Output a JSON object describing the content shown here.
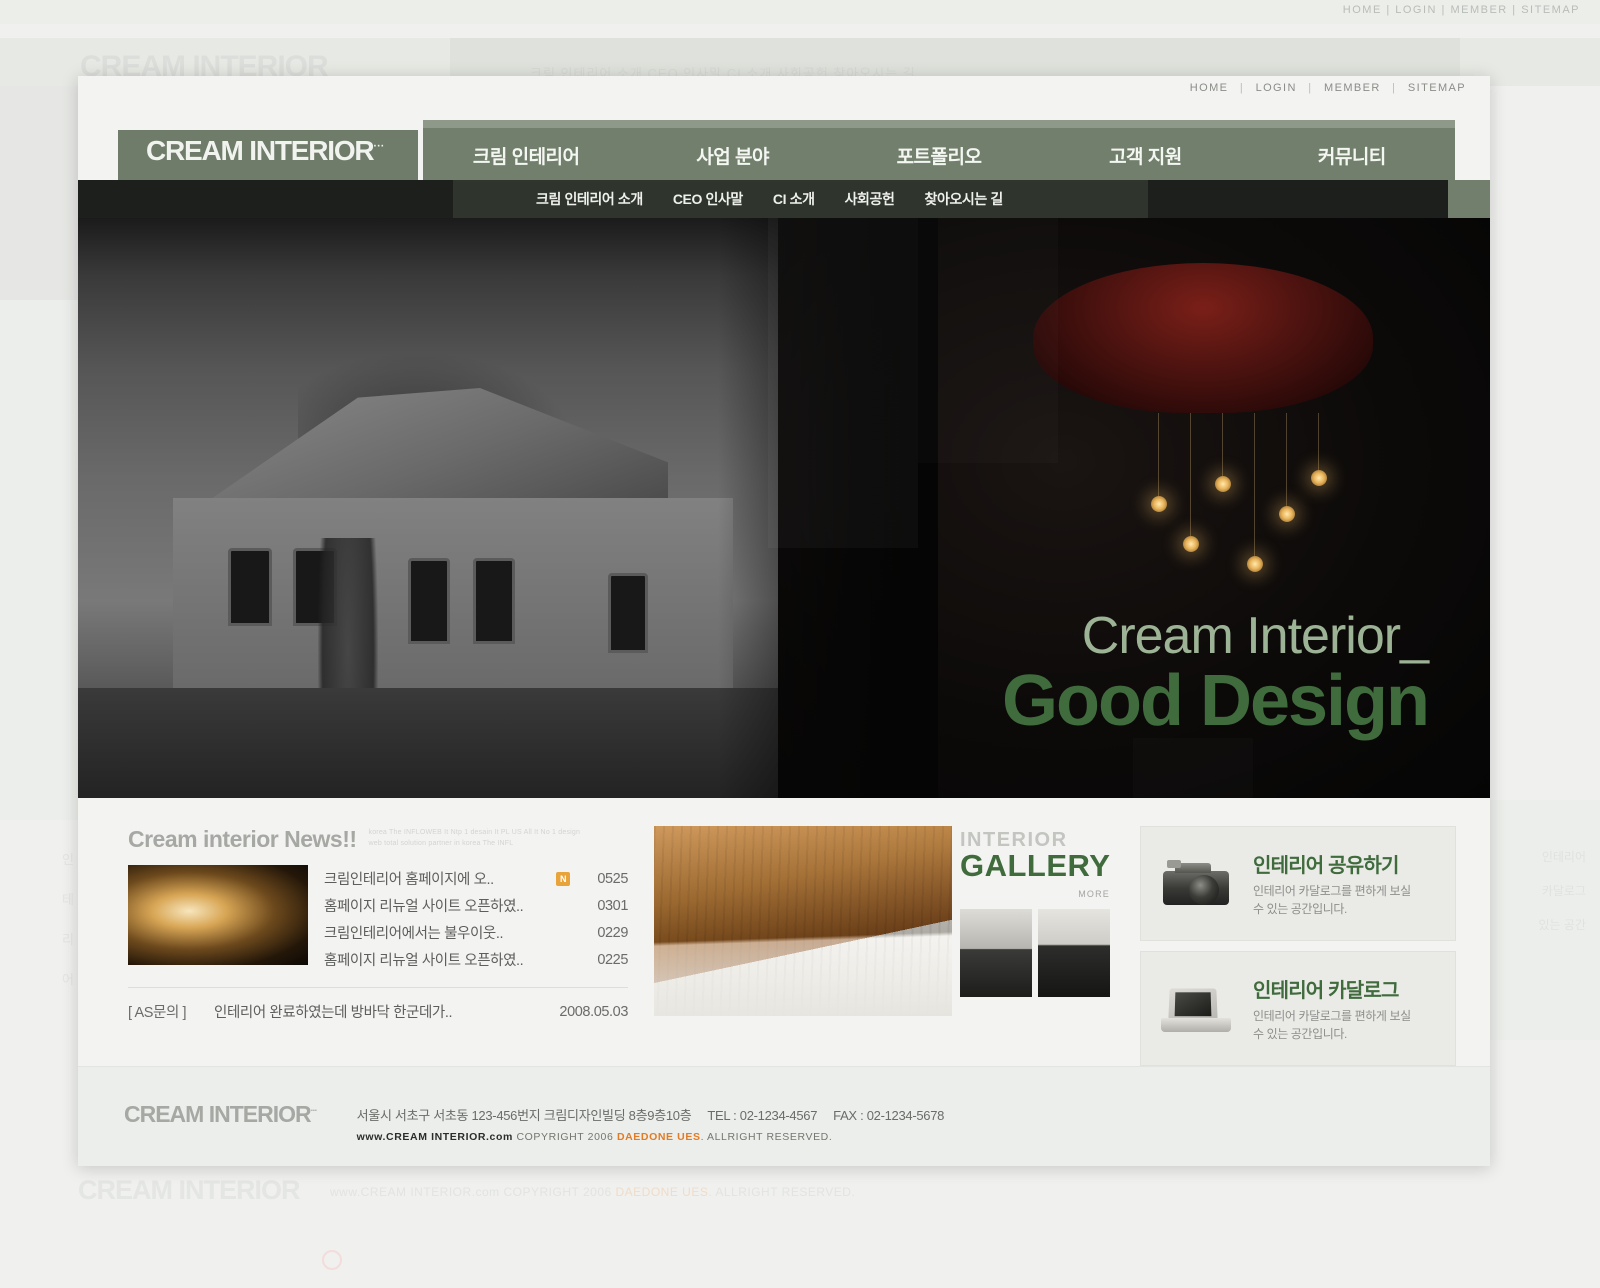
{
  "utility_nav": [
    "HOME",
    "LOGIN",
    "MEMBER",
    "SITEMAP"
  ],
  "brand": {
    "logo": "CREAM INTERIOR",
    "logo_dots": "···"
  },
  "main_nav": [
    {
      "label": "크림 인테리어"
    },
    {
      "label": "사업 분야"
    },
    {
      "label": "포트폴리오"
    },
    {
      "label": "고객 지원"
    },
    {
      "label": "커뮤니티"
    }
  ],
  "sub_nav": [
    {
      "label": "크림 인테리어 소개"
    },
    {
      "label": "CEO 인사말"
    },
    {
      "label": "CI 소개"
    },
    {
      "label": "사회공헌"
    },
    {
      "label": "찾아오시는 길"
    }
  ],
  "hero": {
    "line1": "Cream Interior_",
    "line2": "Good Design"
  },
  "news": {
    "title": "Cream interior News!!",
    "subtitle": "korea The INFLOWEB It Ntp 1 desain It PL US All It No 1 design web total solution partner in korea The INFL",
    "items": [
      {
        "text": "크림인테리어 홈페이지에 오..",
        "badge": "N",
        "date": "0525"
      },
      {
        "text": "홈페이지 리뉴얼 사이트 오픈하였..",
        "badge": "",
        "date": "0301"
      },
      {
        "text": "크림인테리어에서는 불우이웃..",
        "badge": "",
        "date": "0229"
      },
      {
        "text": "홈페이지 리뉴얼 사이트 오픈하였..",
        "badge": "",
        "date": "0225"
      }
    ],
    "footer_item": {
      "tag": "[ AS문의 ]",
      "text": "인테리어 완료하였는데 방바닥 한군데가..",
      "date": "2008.05.03"
    }
  },
  "gallery": {
    "title_top": "INTERIOR",
    "title_bottom": "GALLERY",
    "more": "MORE"
  },
  "banners": [
    {
      "icon": "camera-icon",
      "title": "인테리어 공유하기",
      "desc": "인테리어 카달로그를 편하게 보실\n수 있는 공간입니다."
    },
    {
      "icon": "laptop-icon",
      "title": "인테리어 카달로그",
      "desc": "인테리어 카달로그를 편하게 보실\n수 있는 공간입니다."
    }
  ],
  "footer": {
    "logo": "CREAM INTERIOR",
    "logo_dots": "···",
    "address": "서울시 서초구 서초동 123-456번지 크림디자인빌딩 8층9층10층",
    "tel": "TEL : 02-1234-4567",
    "fax": "FAX : 02-1234-5678",
    "copyright_site": "www.CREAM INTERIOR.com",
    "copyright_pre": "COPYRIGHT 2006",
    "copyright_brand": "DAEDONE UES",
    "copyright_post": ". ALLRIGHT RESERVED."
  },
  "ghost": {
    "utility_nav": "HOME  |  LOGIN  |  MEMBER  |  SITEMAP",
    "logo": "CREAM INTERIOR",
    "subnav": "크림 인테리어 소개     CEO 인사말     CI 소개     사회공헌     찾아오시는 길",
    "bottom_logo": "CREAM INTERIOR",
    "bottom_copy_pre": "www.CREAM INTERIOR.com COPYRIGHT 2006 ",
    "bottom_copy_brand": "DAEDONE UES",
    "bottom_copy_post": ". ALLRIGHT RESERVED.",
    "left_text": "인\n테\n리\n어",
    "right_text": "인테리어\n카달로그\n있는 공간"
  },
  "colors": {
    "brand_green": "#6f7c6a",
    "nav_green": "#727f6c",
    "accent_green": "#3f6b3d",
    "hero_light_green": "#9db395",
    "badge_orange": "#e8a33a",
    "copyright_orange": "#e07b26"
  }
}
